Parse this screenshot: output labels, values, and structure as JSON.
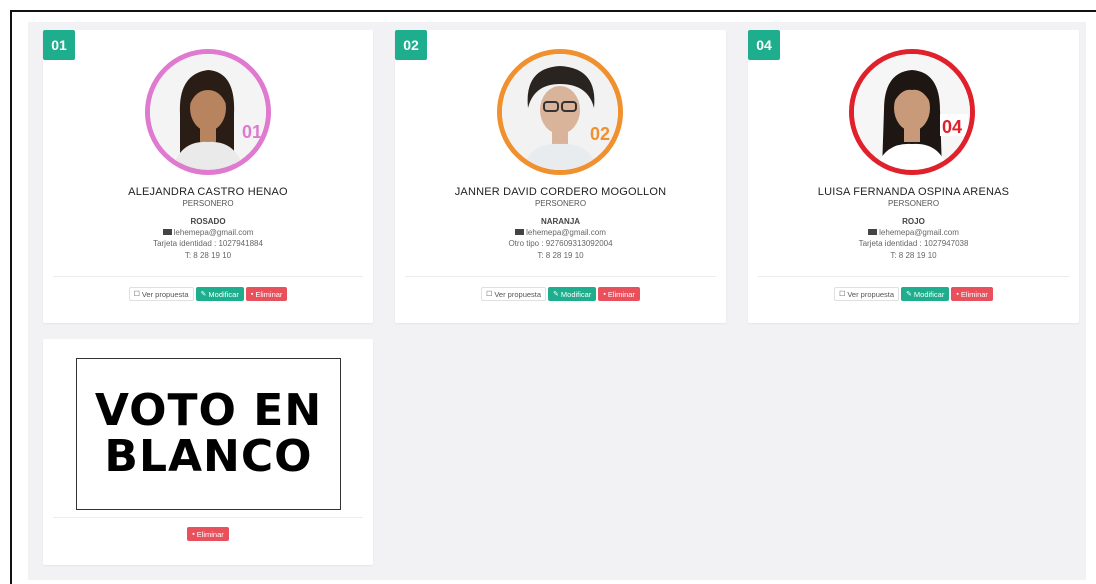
{
  "colors": {
    "accent_green": "#1fae8d",
    "danger_red": "#e8505b",
    "panel_bg": "#f2f2f4"
  },
  "buttons": {
    "view": "Ver propuesta",
    "edit": "Modificar",
    "delete": "Eliminar"
  },
  "candidates": [
    {
      "number": "01",
      "photo_number": "01",
      "ring_color": "#e07ad0",
      "name": "ALEJANDRA CASTRO HENAO",
      "role": "PERSONERO",
      "color_name": "ROSADO",
      "email": "lehemepa@gmail.com",
      "id_line": "Tarjeta identidad : 1027941884",
      "phone": "T: 8 28 19 10"
    },
    {
      "number": "02",
      "photo_number": "02",
      "ring_color": "#f0902f",
      "name": "JANNER DAVID CORDERO MOGOLLON",
      "role": "PERSONERO",
      "color_name": "NARANJA",
      "email": "lehemepa@gmail.com",
      "id_line": "Otro tipo : 927609313092004",
      "phone": "T: 8 28 19 10"
    },
    {
      "number": "04",
      "photo_number": "04",
      "ring_color": "#e0202a",
      "name": "LUISA FERNANDA OSPINA ARENAS",
      "role": "PERSONERO",
      "color_name": "ROJO",
      "email": "lehemepa@gmail.com",
      "id_line": "Tarjeta identidad : 1027947038",
      "phone": "T: 8 28 19 10"
    }
  ],
  "blank_vote": {
    "line1": "VOTO EN",
    "line2": "BLANCO",
    "delete": "Eliminar"
  }
}
